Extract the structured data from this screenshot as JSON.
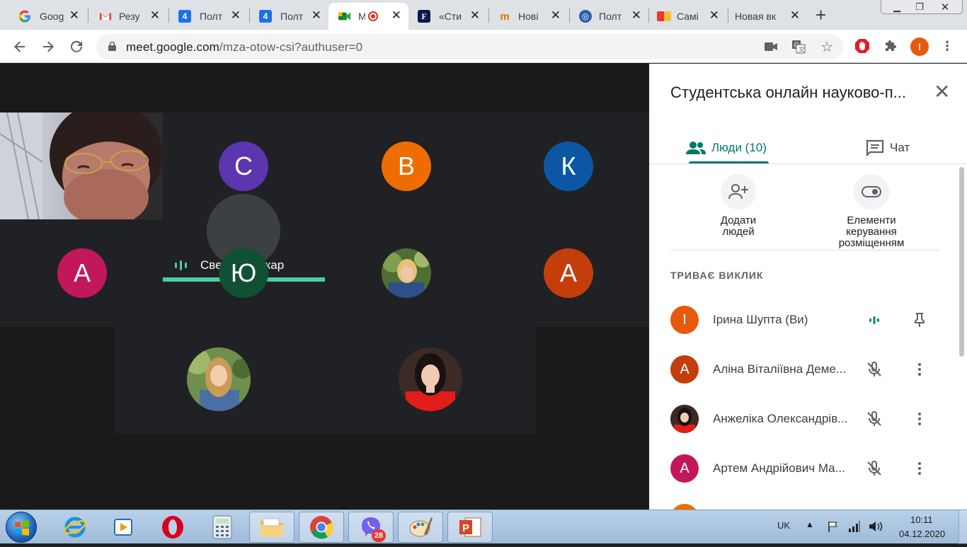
{
  "browser": {
    "tabs": [
      {
        "title": "Goog",
        "favicon": "google-icon",
        "color": "#4285f4"
      },
      {
        "title": "Резу",
        "favicon": "gmail-icon",
        "color": "#ea4335"
      },
      {
        "title": "Полт",
        "favicon": "calendar-4-icon",
        "color": "#1a73e8"
      },
      {
        "title": "Полт",
        "favicon": "calendar-4-icon",
        "color": "#1a73e8"
      },
      {
        "title": "M",
        "favicon": "meet-icon",
        "color": "#00832d",
        "active": true
      },
      {
        "title": "«Сти",
        "favicon": "f-icon",
        "color": "#0a1a4a"
      },
      {
        "title": "Нові",
        "favicon": "m-icon",
        "color": "#e8710a"
      },
      {
        "title": "Полт",
        "favicon": "globe-icon",
        "color": "#2a5db0"
      },
      {
        "title": "Самі",
        "favicon": "flag-icon",
        "color": "#e53935"
      },
      {
        "title": "Новая вк",
        "favicon": "",
        "color": ""
      }
    ],
    "new_tab_label": "+",
    "url_host": "meet.google.com",
    "url_path": "/mza-otow-csi?authuser=0",
    "profile_initial": "I"
  },
  "meet": {
    "tiles": [
      {
        "initial": "С",
        "color": "#5c35b1",
        "name": "Света Свичкар",
        "speaking": true
      },
      {
        "initial": "В",
        "color": "#ef6c00"
      },
      {
        "initial": "К",
        "color": "#0b57a4"
      },
      {
        "initial": "А",
        "color": "#c2185b"
      },
      {
        "initial": "Ю",
        "color": "#0f5132"
      },
      {
        "initial": "",
        "color": "#5d7a3c",
        "photo": true
      },
      {
        "initial": "А",
        "color": "#c43e0c"
      },
      {
        "initial": "",
        "color": "#6b8e5a",
        "photo": true
      },
      {
        "initial": "",
        "color": "#b71c1c",
        "photo": true
      }
    ]
  },
  "panel": {
    "title": "Студентська онлайн науково-п...",
    "tab_people": "Люди (10)",
    "tab_chat": "Чат",
    "add_people_line1": "Додати",
    "add_people_line2": "людей",
    "layout_line1": "Елементи",
    "layout_line2": "керування",
    "layout_line3": "розміщенням",
    "section_label": "ТРИВАЄ ВИКЛИК",
    "participants": [
      {
        "initial": "І",
        "color": "#e8590c",
        "name": "Ірина Шупта (Ви)",
        "status": "speaking",
        "action": "pin"
      },
      {
        "initial": "А",
        "color": "#c43e0c",
        "name": "Аліна Віталіївна Деме...",
        "status": "muted",
        "action": "more"
      },
      {
        "initial": "",
        "color": "#b71c1c",
        "name": "Анжеліка Олександрів...",
        "status": "muted",
        "action": "more",
        "photo": true
      },
      {
        "initial": "А",
        "color": "#c2185b",
        "name": "Артем Андрійович Ма...",
        "status": "muted",
        "action": "more"
      },
      {
        "initial": "",
        "color": "#e8710a",
        "name": "",
        "status": "muted",
        "action": "more"
      }
    ]
  },
  "taskbar": {
    "lang": "UK",
    "time": "10:11",
    "date": "04.12.2020",
    "viber_badge": "28"
  }
}
